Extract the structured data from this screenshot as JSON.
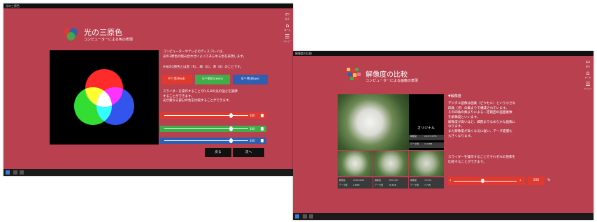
{
  "left_window": {
    "titlebar": "光の三原色",
    "title": "光の三原色",
    "subtitle": "コンピューターによる色の表現",
    "description_1": "コンピューターやテレビのディスプレイは、\n光の3原色の組み合わせによってあらゆる色を表現します。",
    "note": "※光の3原色とは赤（R）、緑（G）、青（B）のことです。",
    "buttons": {
      "r": "R＝赤(Red)",
      "g": "G＝緑(Green)",
      "b": "B＝青(Blue)"
    },
    "description_2": "スライダーを操作することでR,G,Bの光の強さを調節\nすることができます。\n光が重なる部分の色を比較することができます。",
    "sliders": [
      {
        "value": "100",
        "position": 0.78,
        "color": "#e03a30"
      },
      {
        "value": "100",
        "position": 0.78,
        "color": "#3fae49"
      },
      {
        "value": "100",
        "position": 0.78,
        "color": "#2e5fb0"
      }
    ],
    "footer_buttons": [
      "戻る",
      "次へ"
    ]
  },
  "right_window": {
    "titlebar": "解像度の比較",
    "title": "解像度の比較",
    "subtitle": "コンピューターによる画像の表現",
    "heading": "▼解像度",
    "description_1": "デジタル画像は画素（ピクセル）という小さな\n四角（点）の集まりで構成されています。\nその四角の集まりによる一定範囲の画面素数\nを解像度といいます。\n解像度が高いほど、細部までなめらかな画像に\nなります。\nまた解像度が高くなるに従い、データ容量も\n大きくなります。",
    "description_2": "スライダーを操作することでそれぞれの倍率を\n比較することができます。",
    "original_label": "オリジナル",
    "main_caps": [
      [
        "解像度",
        "2072×1555"
      ],
      [
        "データ量",
        "3.22MB"
      ]
    ],
    "thumb_caps": [
      [
        [
          "解像度",
          "1024×690"
        ],
        [
          "データ量",
          "2.6MB"
        ]
      ],
      [
        [
          "解像度",
          "150×107"
        ],
        [
          "データ量",
          "76.6KB"
        ]
      ],
      [
        [
          "解像度",
          "72×54"
        ],
        [
          "データ量",
          "7.7KB"
        ]
      ]
    ],
    "slider": {
      "value": "200",
      "unit": "%",
      "position": 0.45
    }
  },
  "sidebar": {
    "labels": [
      "戻る",
      "ホーム",
      "メニュー"
    ]
  },
  "colors": {
    "bg": "#b8404f",
    "red": "#e03a30",
    "green": "#3fae49",
    "blue": "#2e5fb0"
  }
}
